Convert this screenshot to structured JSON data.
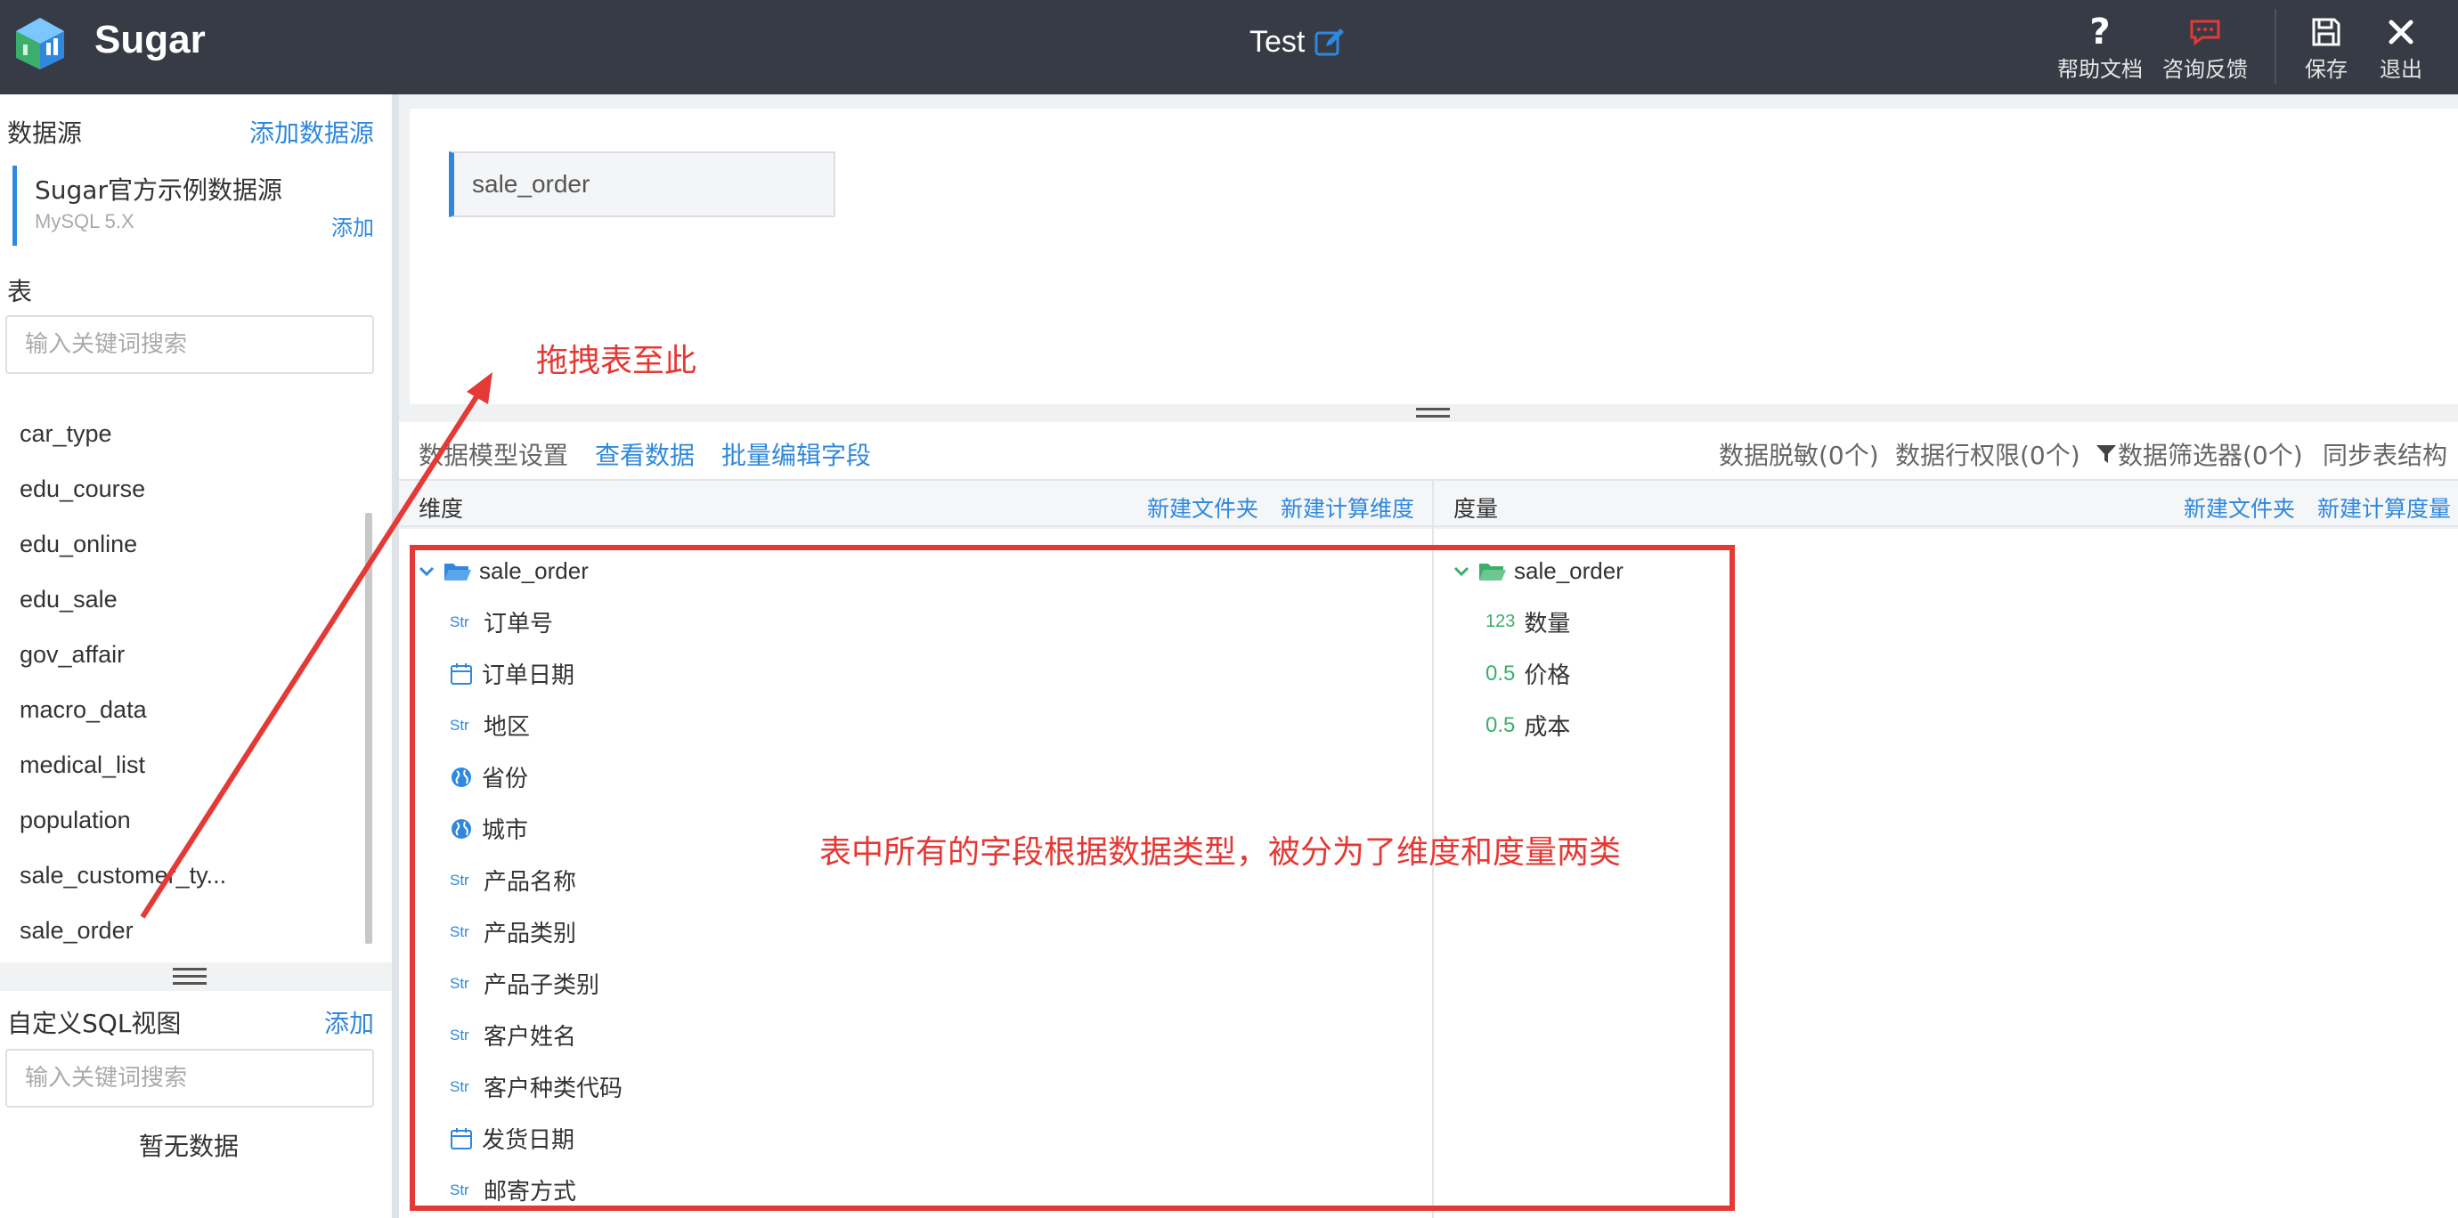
{
  "header": {
    "app_name": "Sugar",
    "page_title": "Test",
    "buttons": {
      "help": "帮助文档",
      "feedback": "咨询反馈",
      "save": "保存",
      "exit": "退出"
    }
  },
  "sidebar": {
    "datasource_title": "数据源",
    "add_datasource": "添加数据源",
    "datasource": {
      "name": "Sugar官方示例数据源",
      "type": "MySQL 5.X",
      "add": "添加"
    },
    "tables_title": "表",
    "search_placeholder": "输入关键词搜索",
    "tables": [
      "car_type",
      "edu_course",
      "edu_online",
      "edu_sale",
      "gov_affair",
      "macro_data",
      "medical_list",
      "population",
      "sale_customer_ty...",
      "sale_order"
    ],
    "sql_title": "自定义SQL视图",
    "sql_add": "添加",
    "sql_search_placeholder": "输入关键词搜索",
    "empty": "暂无数据"
  },
  "drop_area": {
    "chip": "sale_order",
    "hint": "拖拽表至此"
  },
  "toolbar": {
    "model_settings": "数据模型设置",
    "view_data": "查看数据",
    "batch_edit": "批量编辑字段",
    "masking": "数据脱敏(0个)",
    "row_permission": "数据行权限(0个)",
    "filter": "数据筛选器(0个)",
    "sync": "同步表结构"
  },
  "columns": {
    "dimension": "维度",
    "new_folder_dim": "新建文件夹",
    "new_calc_dim": "新建计算维度",
    "measure": "度量",
    "new_folder_mea": "新建文件夹",
    "new_calc_mea": "新建计算度量"
  },
  "dimensions": {
    "folder": "sale_order",
    "fields": [
      {
        "type": "Str",
        "name": "订单号"
      },
      {
        "type": "date",
        "name": "订单日期"
      },
      {
        "type": "Str",
        "name": "地区"
      },
      {
        "type": "geo",
        "name": "省份"
      },
      {
        "type": "geo",
        "name": "城市"
      },
      {
        "type": "Str",
        "name": "产品名称"
      },
      {
        "type": "Str",
        "name": "产品类别"
      },
      {
        "type": "Str",
        "name": "产品子类别"
      },
      {
        "type": "Str",
        "name": "客户姓名"
      },
      {
        "type": "Str",
        "name": "客户种类代码"
      },
      {
        "type": "date",
        "name": "发货日期"
      },
      {
        "type": "Str",
        "name": "邮寄方式"
      }
    ]
  },
  "measures": {
    "folder": "sale_order",
    "fields": [
      {
        "type": "123",
        "name": "数量"
      },
      {
        "type": "0.5",
        "name": "价格"
      },
      {
        "type": "0.5",
        "name": "成本"
      }
    ]
  },
  "annotation": "表中所有的字段根据数据类型，被分为了维度和度量两类",
  "colors": {
    "header_bg": "#363b45",
    "accent": "#2f88dd",
    "annotation": "#e53935",
    "measure": "#3bae6b"
  }
}
